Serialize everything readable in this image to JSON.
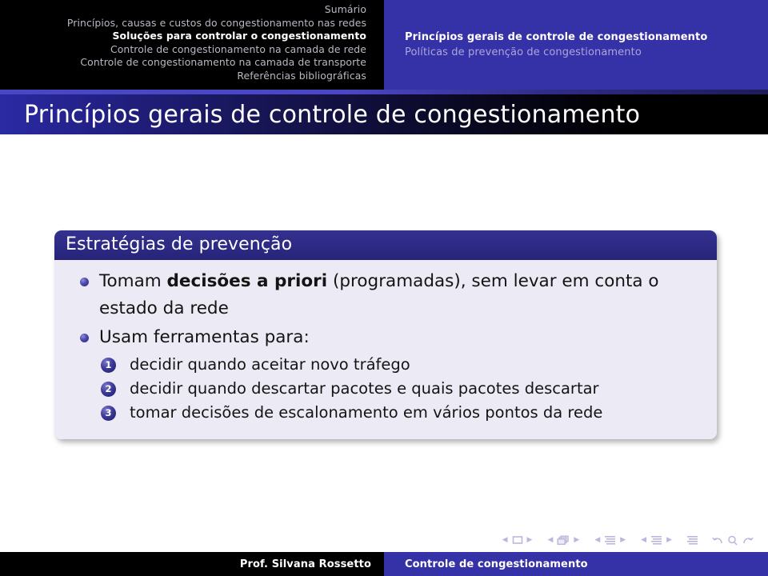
{
  "header": {
    "toc_label": "Sumário",
    "sections": [
      {
        "label": "Princípios, causas e custos do congestionamento nas redes",
        "current": false
      },
      {
        "label": "Soluções para controlar o congestionamento",
        "current": true
      },
      {
        "label": "Controle de congestionamento na camada de rede",
        "current": false
      },
      {
        "label": "Controle de congestionamento na camada de transporte",
        "current": false
      },
      {
        "label": "Referências bibliográficas",
        "current": false
      }
    ],
    "subsections": [
      {
        "label": "Princípios gerais de controle de congestionamento",
        "current": true
      },
      {
        "label": "Políticas de prevenção de congestionamento",
        "current": false
      }
    ],
    "accent_blue": "#3531a6",
    "background_black": "#000000"
  },
  "title": {
    "text": "Princípios gerais de controle de congestionamento"
  },
  "block": {
    "heading": "Estratégias de prevenção",
    "items": [
      {
        "pre": "Tomam ",
        "bold": "decisões a priori",
        "post": " (programadas), sem levar em conta o estado da rede"
      },
      {
        "pre": "Usam ferramentas para:",
        "bold": "",
        "post": ""
      }
    ],
    "enumerated": [
      {
        "num": "1",
        "label": "decidir quando aceitar novo tráfego"
      },
      {
        "num": "2",
        "label": "decidir quando descartar pacotes e quais pacotes descartar"
      },
      {
        "num": "3",
        "label": "tomar decisões de escalonamento em vários pontos da rede"
      }
    ],
    "title_bg": "#2d2a85",
    "body_bg": "#eceaf4"
  },
  "navigation": {
    "icons": [
      "prev-slide-icon",
      "slide-icon",
      "next-slide-icon",
      "prev-frame-icon",
      "frame-icon",
      "next-frame-icon",
      "prev-subsection-icon",
      "subsection-icon",
      "next-subsection-icon",
      "prev-section-icon",
      "section-icon",
      "next-section-icon",
      "document-icon",
      "back-icon",
      "search-icon",
      "forward-icon"
    ],
    "color": "#b9b8dc"
  },
  "footer": {
    "author": "Prof. Silvana Rossetto",
    "title": "Controle de congestionamento"
  }
}
